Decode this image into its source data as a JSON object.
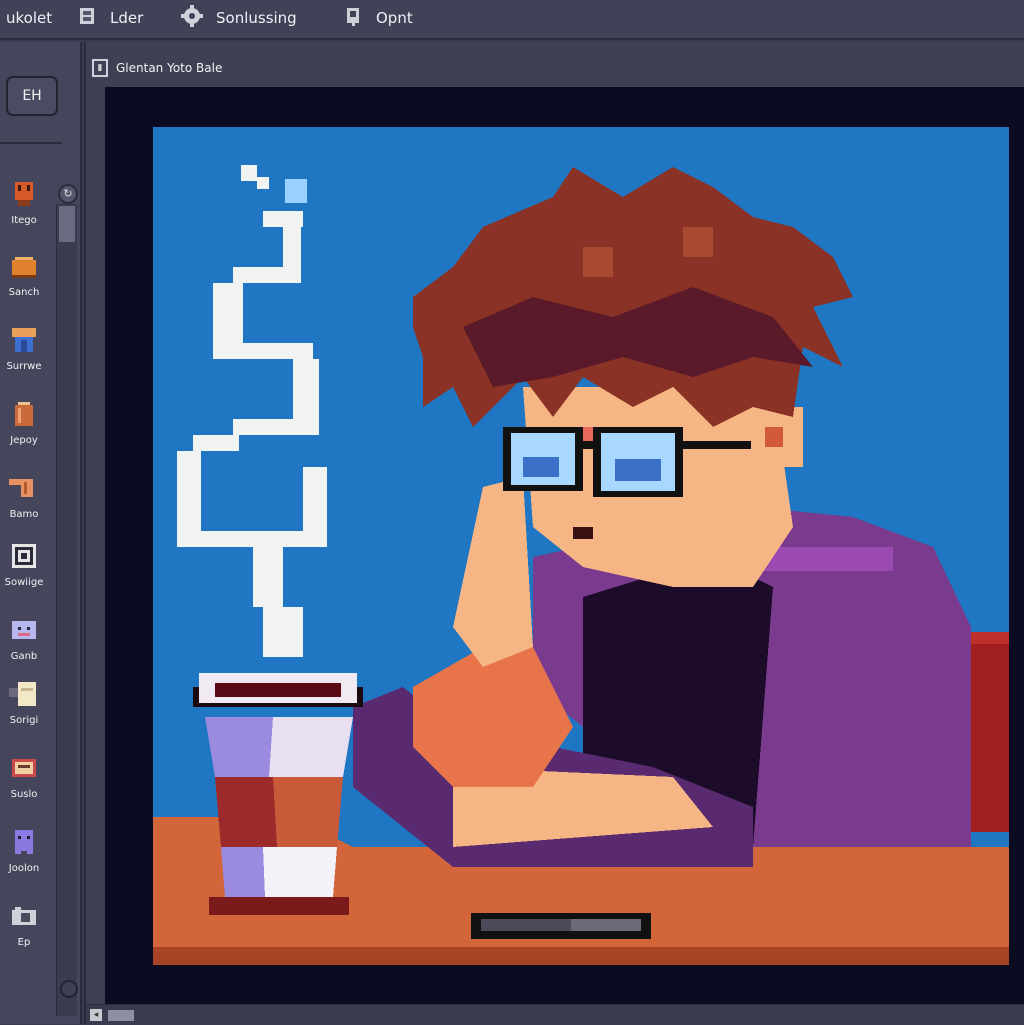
{
  "menu": {
    "items": [
      {
        "label": "ukolet",
        "icon": "file-icon"
      },
      {
        "label": "Lder",
        "icon": "layer-icon"
      },
      {
        "label": "Sonlussing",
        "icon": "gear-icon"
      },
      {
        "label": "Opnt",
        "icon": "paint-bucket-icon"
      }
    ]
  },
  "sidebar": {
    "toggle_label": "EH",
    "tools": [
      {
        "label": "Itego",
        "icon": "brush-icon",
        "color": "#d65a2a"
      },
      {
        "label": "Sanch",
        "icon": "paint-pot-icon",
        "color": "#e0822d"
      },
      {
        "label": "Surrwe",
        "icon": "shirt-icon",
        "color": "#3c6fd0"
      },
      {
        "label": "Jepoy",
        "icon": "jar-icon",
        "color": "#c86a3a"
      },
      {
        "label": "Bamo",
        "icon": "hand-icon",
        "color": "#e89060"
      },
      {
        "label": "Sowiige",
        "icon": "frame-icon",
        "color": "#e6e6e6"
      },
      {
        "label": "Ganb",
        "icon": "robot-icon",
        "color": "#b8b8f0"
      },
      {
        "label": "Sorigi",
        "icon": "note-icon",
        "color": "#f2e8c8"
      },
      {
        "label": "Suslo",
        "icon": "book-icon",
        "color": "#c84a4a"
      },
      {
        "label": "Joolon",
        "icon": "ghost-icon",
        "color": "#8a7ae0"
      },
      {
        "label": "Ep",
        "icon": "camera-icon",
        "color": "#d0d0d8"
      }
    ]
  },
  "document": {
    "tab_title": "Glentan Yoto Bale"
  },
  "colors": {
    "sky": "#1f76c2",
    "desk": "#d3653a",
    "hair": "#8a3226",
    "skin": "#f6b584",
    "shirt": "#7a3a8e",
    "cup_coffee": "#9c2a2a"
  }
}
